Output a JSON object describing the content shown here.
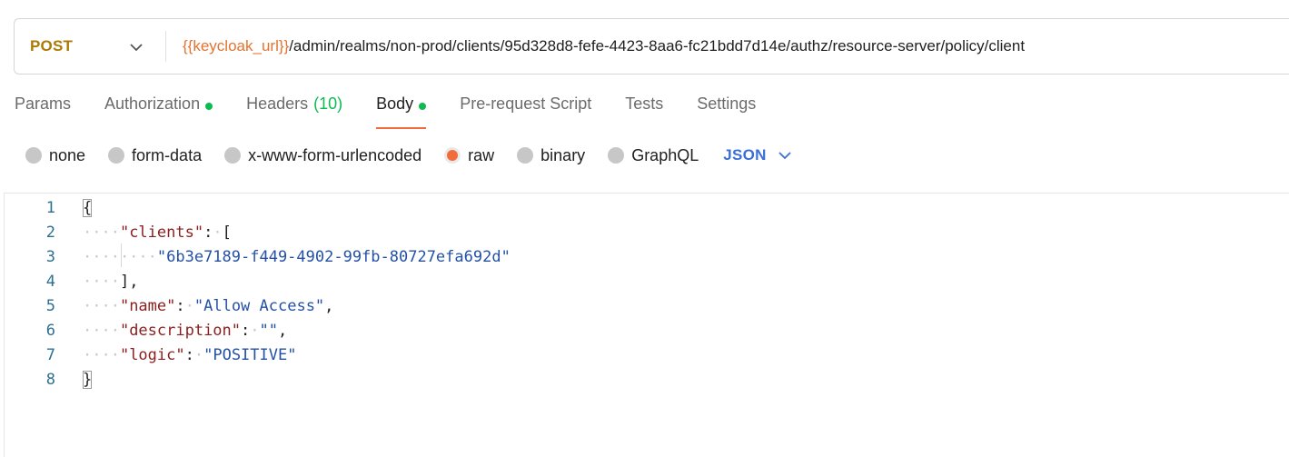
{
  "request": {
    "method": "POST",
    "url_variable": "{{keycloak_url}}",
    "url_path": "/admin/realms/non-prod/clients/95d328d8-fefe-4423-8aa6-fc21bdd7d14e/authz/resource-server/policy/client"
  },
  "tabs": [
    {
      "label": "Params"
    },
    {
      "label": "Authorization"
    },
    {
      "label": "Headers",
      "count": "(10)"
    },
    {
      "label": "Body"
    },
    {
      "label": "Pre-request Script"
    },
    {
      "label": "Tests"
    },
    {
      "label": "Settings"
    }
  ],
  "body_types": [
    {
      "label": "none"
    },
    {
      "label": "form-data"
    },
    {
      "label": "x-www-form-urlencoded"
    },
    {
      "label": "raw",
      "selected": true
    },
    {
      "label": "binary"
    },
    {
      "label": "GraphQL"
    }
  ],
  "language": "JSON",
  "editor": {
    "line_numbers": [
      "1",
      "2",
      "3",
      "4",
      "5",
      "6",
      "7",
      "8"
    ],
    "open_brace": "{",
    "close_brace": "}",
    "clients_key": "\"clients\"",
    "client_id": "\"6b3e7189-f449-4902-99fb-80727efa692d\"",
    "name_key": "\"name\"",
    "name_value": "\"Allow Access\"",
    "description_key": "\"description\"",
    "description_value": "\"\"",
    "logic_key": "\"logic\"",
    "logic_value": "\"POSITIVE\""
  },
  "colors": {
    "method": "#ad7a03",
    "url_variable": "#e3742f",
    "accent": "#f26b3a",
    "status_dot": "#0cbb52",
    "language": "#3b6fd8"
  }
}
